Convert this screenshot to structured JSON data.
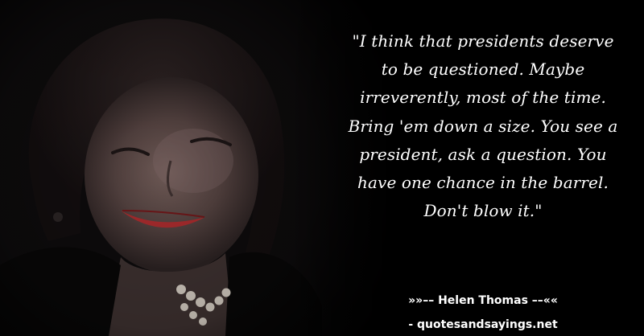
{
  "quote": {
    "lines": [
      "\"I think that presidents deserve",
      "to be questioned. Maybe",
      "irreverently, most of the time.",
      "Bring 'em down a size. You see a",
      "president, ask a question. You",
      "have one chance in the barrel.",
      "Don't blow it.\""
    ]
  },
  "author": "»»–– Helen Thomas ––««",
  "site": "- quotesandsayings.net",
  "colors": {
    "background": "#000000",
    "text": "#ffffff"
  }
}
